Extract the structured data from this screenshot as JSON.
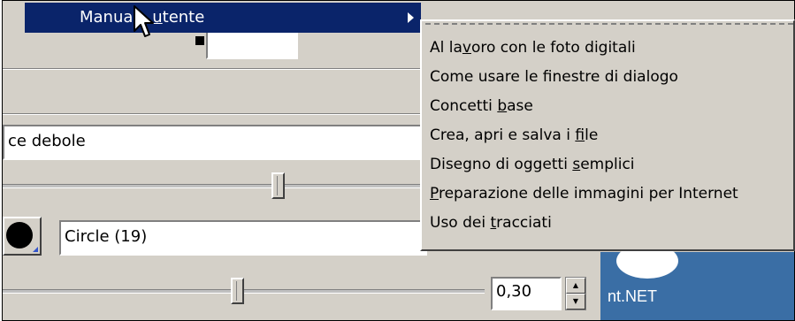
{
  "menu": {
    "parent_item": {
      "label_before": "Manua",
      "label_hidden": "le ",
      "label_after": "utente",
      "underline": "u",
      "label": "Manuale utente"
    },
    "submenu_items": [
      {
        "pre": "Al la",
        "u": "v",
        "post": "oro con le foto digitali"
      },
      {
        "pre": "Come usare le finestre di dialogo",
        "u": "",
        "post": ""
      },
      {
        "pre": "Concetti ",
        "u": "b",
        "post": "ase"
      },
      {
        "pre": "Crea, apri e salva i ",
        "u": "f",
        "post": "ile"
      },
      {
        "pre": "Disegno di oggetti ",
        "u": "s",
        "post": "emplici"
      },
      {
        "pre": "",
        "u": "P",
        "post": "reparazione delle immagini per Internet"
      },
      {
        "pre": "Uso dei ",
        "u": "t",
        "post": "racciati"
      }
    ]
  },
  "panel": {
    "combo1_value": "ce debole",
    "brush_value": "Circle (19)",
    "spin_value": "0,30",
    "background_text": "nt.NET"
  },
  "icons": {
    "cursor": "arrow-cursor-icon",
    "submenu_arrow": "chevron-right-icon",
    "spin_up": "spin-up-icon",
    "spin_down": "spin-down-icon"
  },
  "colors": {
    "menu_highlight": "#0a246a",
    "face": "#d4d0c8",
    "desktop_blue": "#3a6ea5"
  }
}
